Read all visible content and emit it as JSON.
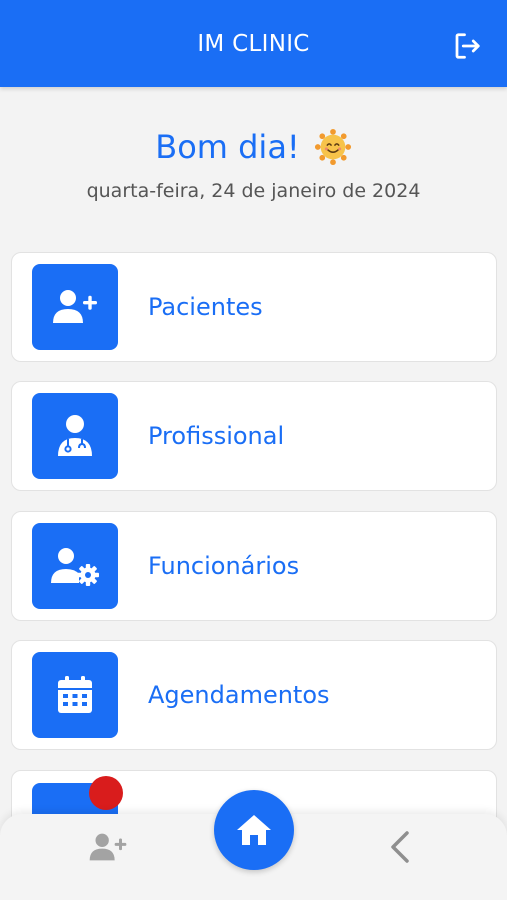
{
  "app": {
    "title": "IM CLINIC"
  },
  "header": {
    "logout_icon": "logout-icon"
  },
  "greeting": {
    "text": "Bom dia!",
    "emoji_icon": "smiling-sun-icon"
  },
  "date_text": "quarta-feira, 24 de janeiro de 2024",
  "menu": {
    "items": [
      {
        "label": "Pacientes",
        "icon": "user-plus-icon"
      },
      {
        "label": "Profissional",
        "icon": "doctor-icon"
      },
      {
        "label": "Funcionários",
        "icon": "user-gear-icon"
      },
      {
        "label": "Agendamentos",
        "icon": "calendar-icon"
      }
    ]
  },
  "bottom_nav": {
    "add_icon": "user-plus-icon",
    "home_icon": "home-icon",
    "back_icon": "chevron-left-icon"
  },
  "colors": {
    "primary": "#1a6ef5",
    "badge": "#d91c1c",
    "background": "#f3f3f3"
  }
}
